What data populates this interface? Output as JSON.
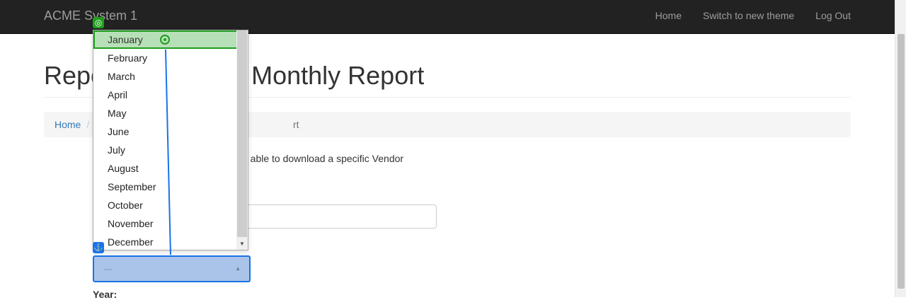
{
  "navbar": {
    "brand": "ACME System 1",
    "links": [
      "Home",
      "Switch to new theme",
      "Log Out"
    ]
  },
  "page": {
    "title_left": "Repo",
    "title_right": "ad Monthly Report",
    "breadcrumb": {
      "home": "Home",
      "separator": "/",
      "current_fragment": "rt"
    },
    "description": "e able to download a specific Vendor",
    "year_label": "Year:"
  },
  "month_select": {
    "value": "---",
    "options": [
      "January",
      "February",
      "March",
      "April",
      "May",
      "June",
      "July",
      "August",
      "September",
      "October",
      "November",
      "December"
    ],
    "selected": "January"
  },
  "colors": {
    "navbar_bg": "#222222",
    "link": "#337ab7",
    "selected_option_bg": "#b8e0b8",
    "select_focus": "#1a73e8"
  },
  "icons": {
    "target": "target-icon",
    "anchor": "anchor-icon",
    "crosshair": "crosshair-icon"
  }
}
